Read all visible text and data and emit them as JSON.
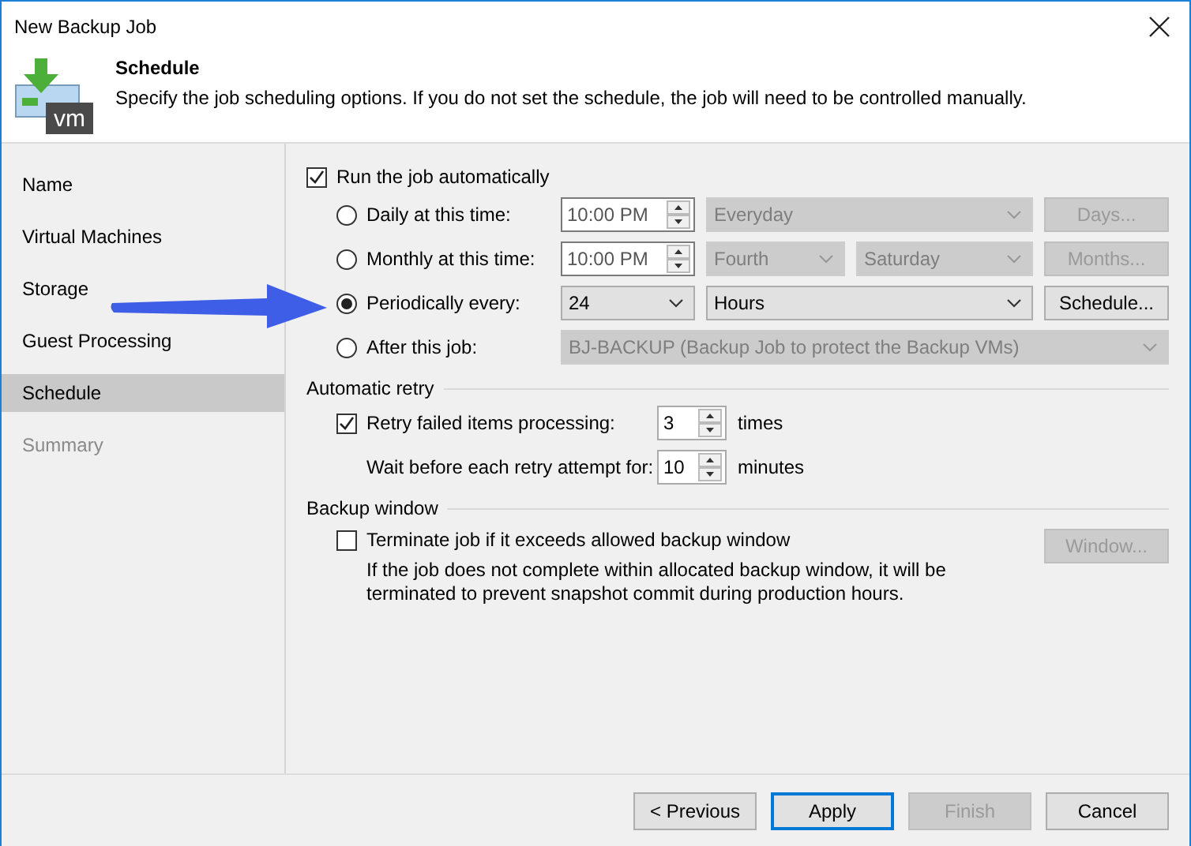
{
  "window": {
    "title": "New Backup Job"
  },
  "header": {
    "icon_text": "vm",
    "title": "Schedule",
    "description": "Specify the job scheduling options. If you do not set the schedule, the job will need to be controlled manually."
  },
  "sidebar": {
    "items": [
      {
        "label": "Name",
        "selected": false,
        "disabled": false
      },
      {
        "label": "Virtual Machines",
        "selected": false,
        "disabled": false
      },
      {
        "label": "Storage",
        "selected": false,
        "disabled": false
      },
      {
        "label": "Guest Processing",
        "selected": false,
        "disabled": false
      },
      {
        "label": "Schedule",
        "selected": true,
        "disabled": false
      },
      {
        "label": "Summary",
        "selected": false,
        "disabled": true
      }
    ]
  },
  "schedule": {
    "run_automatically": {
      "label": "Run the job automatically",
      "checked": true
    },
    "options": [
      {
        "label": "Daily at this time:",
        "selected": false,
        "controls": [
          {
            "kind": "spinner",
            "value": "10:00 PM",
            "disabled": false
          },
          {
            "kind": "dropdown",
            "value": "Everyday",
            "disabled": true
          },
          {
            "kind": "button",
            "value": "Days...",
            "disabled": true
          }
        ]
      },
      {
        "label": "Monthly at this time:",
        "selected": false,
        "controls": [
          {
            "kind": "spinner",
            "value": "10:00 PM",
            "disabled": false
          },
          {
            "kind": "dropdown",
            "value": "Fourth",
            "disabled": true
          },
          {
            "kind": "dropdown",
            "value": "Saturday",
            "disabled": true
          },
          {
            "kind": "button",
            "value": "Months...",
            "disabled": true
          }
        ]
      },
      {
        "label": "Periodically every:",
        "selected": true,
        "controls": [
          {
            "kind": "dropdown",
            "value": "24",
            "disabled": false
          },
          {
            "kind": "dropdown",
            "value": "Hours",
            "disabled": false
          },
          {
            "kind": "button",
            "value": "Schedule...",
            "disabled": false
          }
        ]
      },
      {
        "label": "After this job:",
        "selected": false,
        "controls": [
          {
            "kind": "dropdown",
            "value": "BJ-BACKUP (Backup Job to protect the Backup VMs)",
            "disabled": true
          }
        ]
      }
    ]
  },
  "automatic_retry": {
    "title": "Automatic retry",
    "retry": {
      "label": "Retry failed items processing:",
      "checked": true,
      "value": "3",
      "unit": "times"
    },
    "wait": {
      "label": "Wait before each retry attempt for:",
      "value": "10",
      "unit": "minutes"
    }
  },
  "backup_window": {
    "title": "Backup window",
    "terminate": {
      "label": "Terminate job if it exceeds allowed backup window",
      "checked": false
    },
    "description": "If the job does not complete within allocated backup window, it will be terminated to prevent snapshot commit during production hours.",
    "button": {
      "label": "Window...",
      "disabled": true
    }
  },
  "buttons": [
    {
      "label": "< Previous",
      "disabled": false,
      "default": false
    },
    {
      "label": "Apply",
      "disabled": false,
      "default": true
    },
    {
      "label": "Finish",
      "disabled": true,
      "default": false
    },
    {
      "label": "Cancel",
      "disabled": false,
      "default": false
    }
  ]
}
